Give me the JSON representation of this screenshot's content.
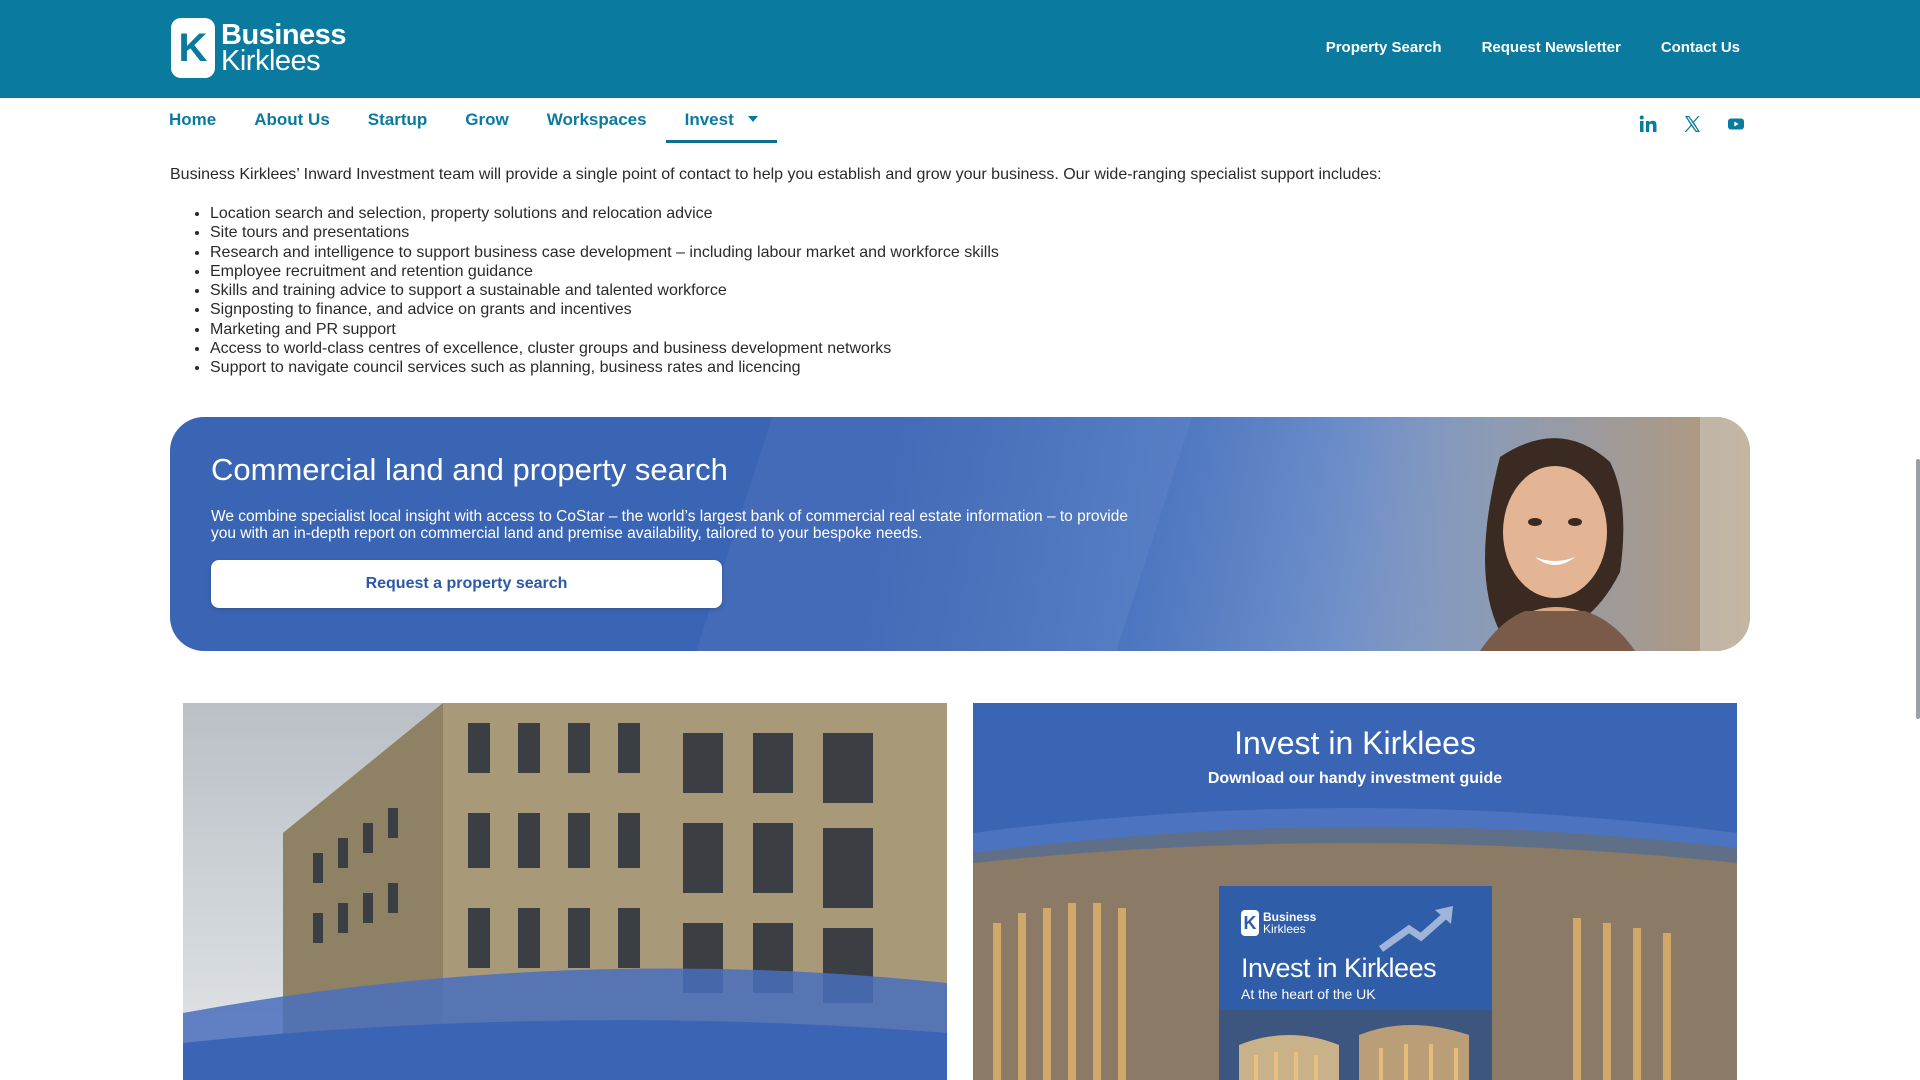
{
  "header": {
    "logo_line1": "Business",
    "logo_line2": "Kirklees",
    "logo_letter": "K",
    "links": [
      "Property Search",
      "Request Newsletter",
      "Contact Us"
    ]
  },
  "nav": {
    "items": [
      "Home",
      "About Us",
      "Startup",
      "Grow",
      "Workspaces",
      "Invest"
    ],
    "active": "Invest"
  },
  "social": [
    "linkedin-icon",
    "x-icon",
    "youtube-icon"
  ],
  "intro": {
    "text": "Business Kirklees’ Inward Investment team will provide a single point of contact to help you establish and grow your business. Our wide-ranging specialist support includes:",
    "bullets": [
      "Location search and selection, property solutions and relocation advice",
      "Site tours and presentations",
      "Research and intelligence to support business case development – including labour market and workforce skills",
      "Employee recruitment and retention guidance",
      "Skills and training advice to support a sustainable and talented workforce",
      "Signposting to finance, and advice on grants and incentives",
      "Marketing and PR support",
      "Access to world-class centres of excellence, cluster groups and business development networks",
      "Support to navigate council services such as planning, business rates and licencing"
    ]
  },
  "banner": {
    "title": "Commercial land and property search",
    "body": "We combine specialist local insight with access to CoStar – the world’s largest bank of commercial real estate information – to provide you with an in-depth report on commercial land and premise availability, tailored to your bespoke needs.",
    "button": "Request a property search"
  },
  "invest_card": {
    "title": "Invest in Kirklees",
    "subtitle": "Download our handy investment guide",
    "guide_logo_line1": "Business",
    "guide_logo_line2": "Kirklees",
    "guide_title": "Invest in Kirklees",
    "guide_subtitle": "At the heart of the UK"
  },
  "colors": {
    "header": "#0a7a9f",
    "banner": "#3a64b4",
    "nav_text": "#0a7a9f"
  }
}
